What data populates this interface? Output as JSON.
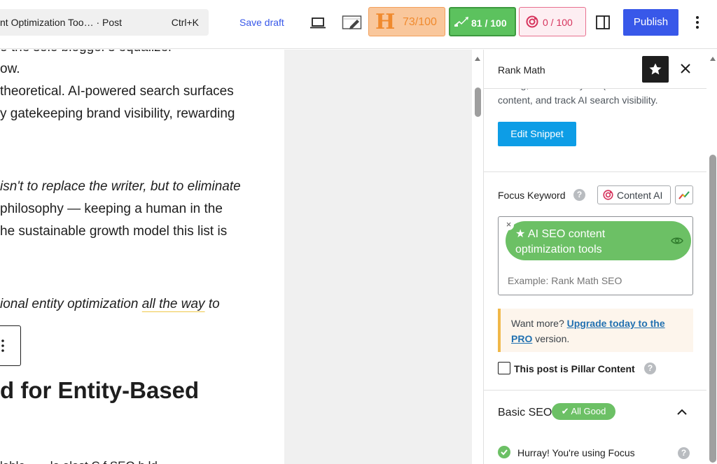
{
  "toolbar": {
    "command_title": "nt Optimization Too… · Post",
    "command_shortcut": "Ctrl+K",
    "save_draft": "Save draft",
    "headline_score": "73/100",
    "headline_icon_letter": "H",
    "seo_score": "81 / 100",
    "content_ai_score": "0 / 100",
    "publish": "Publish"
  },
  "editor": {
    "lines": [
      "o the solo blogger's equalizer",
      "ow.",
      " theoretical. AI-powered search surfaces",
      "y gatekeeping brand visibility, rewarding",
      "isn't to replace the writer, but to eliminate",
      "philosophy — keeping a human in the",
      "he sustainable growth model this list is"
    ],
    "italic_line_a": "ional entity optimization ",
    "italic_line_link": "all the way",
    "italic_line_b": " to",
    "heading": "d for Entity-Based",
    "bottom_fragment": "lable … ∙ la alast  C  f  SEO h ld"
  },
  "sidebar": {
    "title": "Rank Math",
    "intro_cut": "mizing, … monitor yo… (…",
    "intro_line": "content, and track AI search visibility.",
    "edit_snippet": "Edit Snippet",
    "focus_keyword_label": "Focus Keyword",
    "help_glyph": "?",
    "content_ai_button": "Content AI",
    "keyword_tag_line1": "AI SEO content",
    "keyword_tag_line2": "optimization tools",
    "keyword_remove": "×",
    "keyword_placeholder": "Example: Rank Math SEO",
    "notice_prefix": "Want more? ",
    "notice_link_1": "Upgrade today to the",
    "notice_link_2": "PRO",
    "notice_suffix": " version.",
    "pillar_label": "This post is Pillar Content",
    "basic_seo_label": "Basic SEO",
    "basic_seo_badge": "✔ All Good",
    "check_item_text": "Hurray! You're using Focus"
  },
  "colors": {
    "accent": "#3858e9",
    "good": "#6cc065",
    "headline_orange": "#f08a2e",
    "content_ai_pink": "#d6335c",
    "snippet_blue": "#0d9de6"
  }
}
